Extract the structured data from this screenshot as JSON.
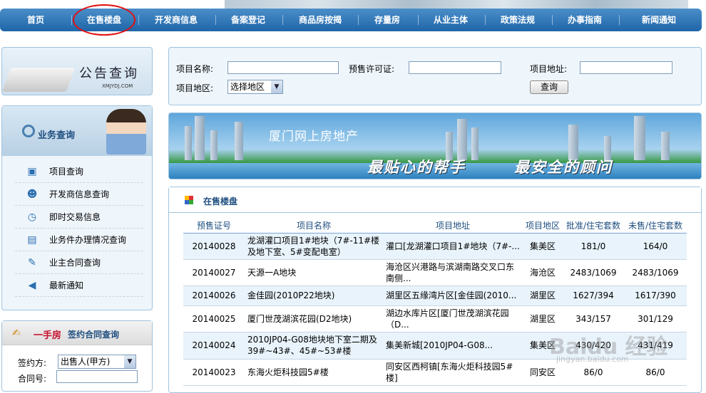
{
  "nav": {
    "items": [
      "首页",
      "在售楼盘",
      "开发商信息",
      "备案登记",
      "商品房按揭",
      "存量房",
      "从业主体",
      "政策法规",
      "办事指南",
      "新闻通知"
    ]
  },
  "notice_ad": {
    "title": "公告查询",
    "subtitle": "XMJYDJ.COM"
  },
  "business": {
    "title": "业务查询",
    "items": [
      "项目查询",
      "开发商信息查询",
      "即时交易信息",
      "业务件办理情况查询",
      "业主合同查询",
      "最新通知"
    ]
  },
  "contract_query": {
    "title_a": "一手房",
    "title_b": "签约合同查询",
    "party_label": "签约方:",
    "party_value": "出售人(甲方)",
    "number_label": "合同号:"
  },
  "search": {
    "project_name_label": "项目名称:",
    "permit_label": "预售许可证:",
    "address_label": "项目地址:",
    "district_label": "项目地区:",
    "district_value": "选择地区",
    "query_button": "查询"
  },
  "hero": {
    "title": "厦门网上房地产",
    "slogan_left": "最贴心的帮手",
    "slogan_right": "最安全的顾问"
  },
  "listing": {
    "title": "在售楼盘",
    "columns": [
      "预售证号",
      "项目名称",
      "项目地址",
      "项目地区",
      "批准/住宅套数",
      "未售/住宅套数"
    ],
    "rows": [
      [
        "20140028",
        "龙湖灌口项目1#地块（7#-11#楼及地下室、5#变配电室）",
        "灌口[龙湖灌口项目1#地块（7#-...",
        "集美区",
        "181/0",
        "164/0"
      ],
      [
        "20140027",
        "天源一A地块",
        "海沧区兴港路与滨湖南路交叉口东南侧...",
        "海沧区",
        "2483/1069",
        "2483/1069"
      ],
      [
        "20140026",
        "金佳园(2010P22地块)",
        "湖里区五缘湾片区[金佳园(2010...",
        "湖里区",
        "1627/394",
        "1617/390"
      ],
      [
        "20140025",
        "厦门世茂湖滨花园(D2地块)",
        "湖边水库片区[厦门世茂湖滨花园（D...",
        "湖里区",
        "343/157",
        "301/129"
      ],
      [
        "20140024",
        "2010JP04-G08地块地下室二期及39#~43#、45#~53#楼",
        "集美新城[2010JP04-G08...",
        "集美区",
        "430/420",
        "431/419"
      ],
      [
        "20140023",
        "东海火炬科技园5#楼",
        "同安区西柯镇[东海火炬科技园5#楼]",
        "同安区",
        "86/0",
        "86/0"
      ]
    ]
  },
  "watermark": {
    "main": "Baidu 经验",
    "sub": "jingyan.baidu.com"
  }
}
